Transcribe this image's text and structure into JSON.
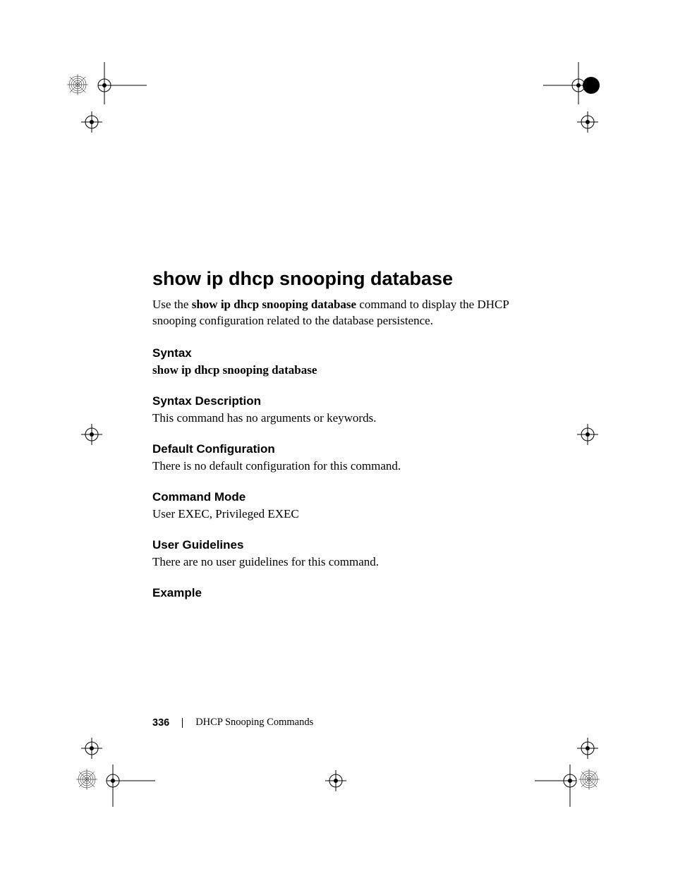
{
  "title": "show ip dhcp snooping database",
  "intro_prefix": "Use the ",
  "intro_bold": "show ip dhcp snooping database",
  "intro_suffix": " command to display the DHCP snooping configuration related to the database persistence.",
  "sections": {
    "syntax": {
      "heading": "Syntax",
      "line": "show ip dhcp snooping database"
    },
    "syntax_description": {
      "heading": "Syntax Description",
      "body": "This command has no arguments or keywords."
    },
    "default_configuration": {
      "heading": "Default Configuration",
      "body": "There is no default configuration for this command."
    },
    "command_mode": {
      "heading": "Command Mode",
      "body": "User EXEC, Privileged EXEC"
    },
    "user_guidelines": {
      "heading": "User Guidelines",
      "body": "There are no user guidelines for this command."
    },
    "example": {
      "heading": "Example"
    }
  },
  "footer": {
    "page_number": "336",
    "section": "DHCP Snooping Commands"
  }
}
